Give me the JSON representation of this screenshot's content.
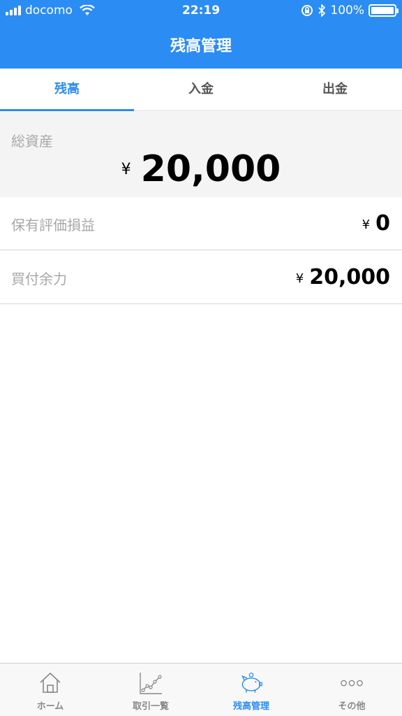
{
  "status_bar": {
    "carrier": "docomo",
    "time": "22:19",
    "battery": "100%"
  },
  "header": {
    "title": "残高管理"
  },
  "tabs": [
    {
      "label": "残高",
      "active": true
    },
    {
      "label": "入金",
      "active": false
    },
    {
      "label": "出金",
      "active": false
    }
  ],
  "total_assets": {
    "label": "総資産",
    "currency": "¥",
    "value": "20,000"
  },
  "rows": [
    {
      "label": "保有評価損益",
      "currency": "¥",
      "value": "0"
    },
    {
      "label": "買付余力",
      "currency": "¥",
      "value": "20,000"
    }
  ],
  "tabbar": [
    {
      "label": "ホーム",
      "icon": "home-icon",
      "active": false
    },
    {
      "label": "取引一覧",
      "icon": "chart-icon",
      "active": false
    },
    {
      "label": "残高管理",
      "icon": "piggy-bank-icon",
      "active": true
    },
    {
      "label": "その他",
      "icon": "more-icon",
      "active": false
    }
  ],
  "colors": {
    "accent": "#2b8cf4",
    "label_gray": "#a8a8a8",
    "inactive_tab": "#888888"
  }
}
